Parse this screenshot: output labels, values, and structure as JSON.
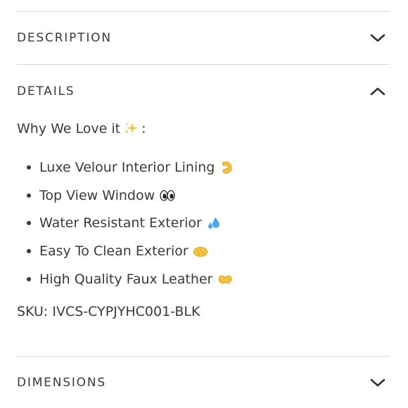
{
  "sections": [
    {
      "title": "DESCRIPTION",
      "expanded": false,
      "chevron_icon": "chevron-down-icon"
    },
    {
      "title": "DETAILS",
      "expanded": true,
      "chevron_icon": "chevron-up-icon"
    },
    {
      "title": "DIMENSIONS",
      "expanded": false,
      "chevron_icon": "chevron-down-icon"
    }
  ],
  "details": {
    "intro_text": "Why We Love it",
    "intro_emoji": "sparkles-emoji",
    "intro_suffix": ":",
    "features": [
      {
        "label": "Luxe Velour Interior Lining",
        "emoji": "pinching-hand-emoji"
      },
      {
        "label": "Top View Window",
        "emoji": "eyes-emoji"
      },
      {
        "label": "Water Resistant Exterior",
        "emoji": "sweat-droplets-emoji"
      },
      {
        "label": "Easy To Clean Exterior",
        "emoji": "sponge-emoji"
      },
      {
        "label": "High Quality Faux Leather",
        "emoji": "heart-hands-emoji"
      }
    ],
    "sku_label": "SKU:",
    "sku_value": "IVCS-CYPJYHC001-BLK"
  },
  "colors": {
    "text": "#3a3a3a",
    "divider": "#d6d6d6",
    "emoji_yellow": "#f5c441",
    "emoji_blue": "#4aa9e9"
  }
}
